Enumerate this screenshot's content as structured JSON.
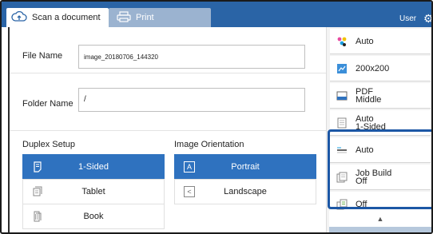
{
  "tabs": {
    "scan": "Scan a document",
    "print": "Print"
  },
  "header": {
    "user_label": "User"
  },
  "fields": {
    "file_name_label": "File Name",
    "file_name_value": "image_20180706_144320",
    "folder_name_label": "Folder Name",
    "folder_name_value": "/"
  },
  "duplex": {
    "label": "Duplex Setup",
    "options": [
      {
        "label": "1-Sided",
        "icon": "one-sided-icon",
        "selected": true
      },
      {
        "label": "Tablet",
        "icon": "tablet-icon",
        "selected": false
      },
      {
        "label": "Book",
        "icon": "book-icon",
        "selected": false
      }
    ]
  },
  "orientation": {
    "label": "Image Orientation",
    "options": [
      {
        "label": "Portrait",
        "icon": "portrait-icon",
        "selected": true
      },
      {
        "label": "Landscape",
        "icon": "landscape-icon",
        "selected": false
      }
    ]
  },
  "sidebar": {
    "items": [
      {
        "line1": "Auto",
        "line2": "",
        "icon": "color-mode-icon"
      },
      {
        "line1": "200x200",
        "line2": "",
        "icon": "resolution-icon"
      },
      {
        "line1": "PDF",
        "line2": "Middle",
        "icon": "file-format-icon"
      },
      {
        "line1": "Auto",
        "line2": "1-Sided",
        "icon": "original-size-icon"
      },
      {
        "line1": "Auto",
        "line2": "",
        "icon": "density-icon"
      },
      {
        "line1": "Job Build",
        "line2": "Off",
        "icon": "job-build-icon"
      },
      {
        "line1": "Off",
        "line2": "",
        "icon": "blank-page-icon"
      }
    ]
  },
  "colors": {
    "header_blue": "#2a64a6",
    "selected_blue": "#2f72bf",
    "highlight_border": "#1c57a5"
  }
}
